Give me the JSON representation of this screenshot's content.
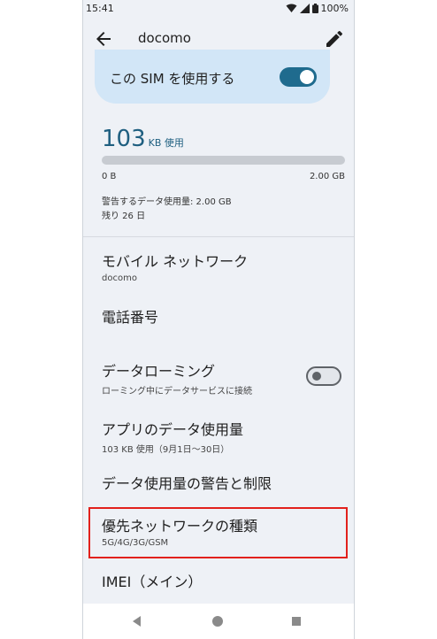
{
  "status": {
    "time": "15:41",
    "battery": "100%"
  },
  "appbar": {
    "title": "docomo"
  },
  "sim": {
    "label": "この SIM を使用する",
    "enabled": true
  },
  "usage": {
    "amount": "103",
    "unit": "KB 使用",
    "progress": 0.0,
    "min_label": "0 B",
    "max_label": "2.00 GB",
    "warning": "警告するデータ使用量: 2.00 GB",
    "remaining": "残り 26 日"
  },
  "items": [
    {
      "title": "モバイル ネットワーク",
      "subtitle": "docomo"
    },
    {
      "title": "電話番号",
      "subtitle": ""
    },
    {
      "title": "データローミング",
      "subtitle": "ローミング中にデータサービスに接続",
      "toggle": false
    },
    {
      "title": "アプリのデータ使用量",
      "subtitle": "103 KB 使用（9月1日〜30日）"
    },
    {
      "title": "データ使用量の警告と制限",
      "subtitle": ""
    },
    {
      "title": "優先ネットワークの種類",
      "subtitle": "5G/4G/3G/GSM",
      "highlighted": true
    },
    {
      "title": "IMEI（メイン）",
      "subtitle": ""
    }
  ],
  "colors": {
    "accent": "#1f6b8e",
    "highlight": "#e2211c",
    "card": "#d2e6f7",
    "background": "#eef1f6"
  },
  "icons": [
    "back-arrow-icon",
    "pencil-icon",
    "wifi-icon",
    "signal-icon",
    "battery-icon"
  ]
}
